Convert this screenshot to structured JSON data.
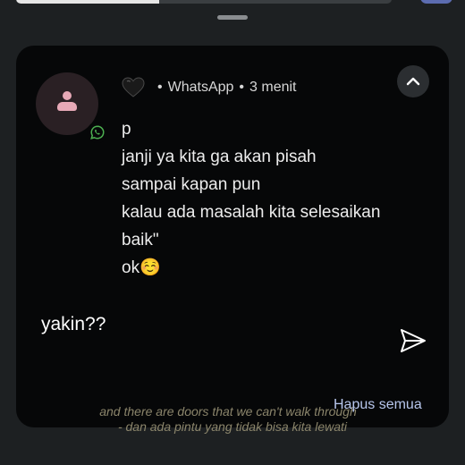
{
  "notification": {
    "app_name": "WhatsApp",
    "time_ago": "3 menit",
    "sender_icon": "black-heart-icon",
    "avatar_icon": "person-icon",
    "badge_icon": "whatsapp-icon",
    "collapse_icon": "chevron-up-icon",
    "separator": "•",
    "messages": [
      "p",
      "janji ya kita ga akan pisah",
      "sampai kapan pun",
      "kalau ada masalah kita selesaikan",
      "baik\"",
      "ok☺️"
    ]
  },
  "reply": {
    "text": "yakin??",
    "send_icon": "send-icon"
  },
  "actions": {
    "clear_all_label": "Hapus semua"
  },
  "caption": {
    "line1": "and there are doors that we can't walk through",
    "line2": "- dan ada pintu yang tidak bisa kita lewati"
  },
  "colors": {
    "card_bg": "#060708",
    "page_bg": "#1d2022",
    "avatar_bg": "#2a2024",
    "avatar_fg": "#e7a9b7",
    "accent_link": "#b7c6ec",
    "whatsapp_green": "#4caf50"
  }
}
